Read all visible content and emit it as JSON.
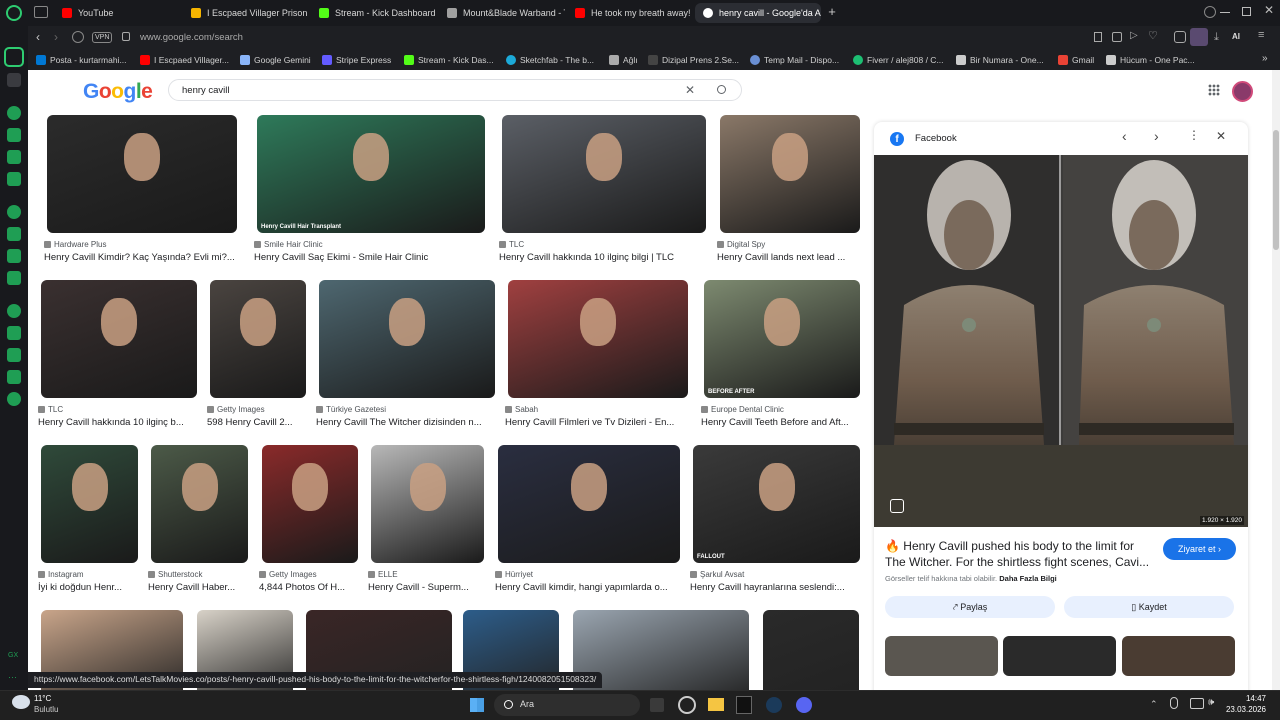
{
  "browser": {
    "tabs": [
      {
        "label": "YouTube",
        "color": "#ff0000"
      },
      {
        "label": "I Escpaed Villager Prison",
        "color": "#f5b400"
      },
      {
        "label": "Stream - Kick Dashboard",
        "color": "#53fc18"
      },
      {
        "label": "Mount&Blade Warband - T",
        "color": "#a0a0a0"
      },
      {
        "label": "He took my breath away!",
        "color": "#ff0000"
      },
      {
        "label": "henry cavill - Google'da A",
        "color": "#ffffff"
      }
    ],
    "vpn_label": "VPN",
    "url": "www.google.com/search",
    "ai_label": "AI",
    "bookmarks": [
      {
        "label": "Posta - kurtarmahi..."
      },
      {
        "label": "I Escpaed Villager..."
      },
      {
        "label": "Google Gemini"
      },
      {
        "label": "Stripe Express"
      },
      {
        "label": "Stream - Kick Das..."
      },
      {
        "label": "Sketchfab - The b..."
      },
      {
        "label": "Ağlı"
      },
      {
        "label": "Dizipal Prens 2.Se..."
      },
      {
        "label": "Temp Mail - Dispo..."
      },
      {
        "label": "Fiverr / alej808 / C..."
      },
      {
        "label": "Bir Numara - One..."
      },
      {
        "label": "Gmail"
      },
      {
        "label": "Hücum - One Pac..."
      }
    ],
    "status_url": "https://www.facebook.com/LetsTalkMovies.co/posts/-henry-cavill-pushed-his-body-to-the-limit-for-the-witcherfor-the-shirtless-figh/1240082051508323/"
  },
  "google": {
    "logo": "Google",
    "query": "henry cavill",
    "results": [
      {
        "source": "Hardware Plus",
        "title": "Henry Cavill Kimdir? Kaç Yaşında? Evli mi?...",
        "color": "#2b2b2b"
      },
      {
        "source": "Smile Hair Clinic",
        "title": "Henry Cavill Saç Ekimi - Smile Hair Clinic",
        "color": "#2e7a5a",
        "overlay": "Henry Cavill Hair Transplant"
      },
      {
        "source": "TLC",
        "title": "Henry Cavill hakkında 10 ilginç bilgi | TLC",
        "color": "#5b5f66"
      },
      {
        "source": "Digital Spy",
        "title": "Henry Cavill lands next lead ...",
        "color": "#8a7868"
      },
      {
        "source": "TLC",
        "title": "Henry Cavill hakkında 10 ilginç b...",
        "color": "#3a3030"
      },
      {
        "source": "Getty Images",
        "title": "598 Henry Cavill 2...",
        "color": "#4a4440"
      },
      {
        "source": "Türkiye Gazetesi",
        "title": "Henry Cavill The Witcher dizisinden n...",
        "color": "#4e6770"
      },
      {
        "source": "Sabah",
        "title": "Henry Cavill Filmleri ve Tv Dizileri - En...",
        "color": "#a04040"
      },
      {
        "source": "Europe Dental Clinic",
        "title": "Henry Cavill Teeth Before and Aft...",
        "color": "#7d8a70",
        "overlay": "BEFORE  AFTER"
      },
      {
        "source": "Instagram",
        "title": "İyi ki doğdun Henr...",
        "color": "#2f4a3a"
      },
      {
        "source": "Shutterstock",
        "title": "Henry Cavill Haber...",
        "color": "#4c5a48"
      },
      {
        "source": "Getty Images",
        "title": "4,844 Photos Of H...",
        "color": "#8a2a2a"
      },
      {
        "source": "ELLE",
        "title": "Henry Cavill - Superm...",
        "color": "#b8b8b8"
      },
      {
        "source": "Hürriyet",
        "title": "Henry Cavill kimdir, hangi yapımlarda o...",
        "color": "#2a2e40"
      },
      {
        "source": "Şarkul Avsat",
        "title": "Henry Cavill hayranlarına seslendi:...",
        "color": "#3a3a3a",
        "overlay": "FALLOUT"
      }
    ],
    "row4_colors": [
      "#c9a58a",
      "#d8d2c8",
      "#3a2626",
      "#2d5d8a",
      "#9aa5b0",
      "#2a2a2a"
    ],
    "panel": {
      "site": "Facebook",
      "dimensions": "1.920 × 1.920",
      "title": "🔥 Henry Cavill pushed his body to the limit for The Witcher. For the shirtless fight scenes, Cavi...",
      "visit_label": "Ziyaret et",
      "copyright": "Görseller telif hakkına tabi olabilir.",
      "learn_more": "Daha Fazla Bilgi",
      "share_label": "Paylaş",
      "save_label": "Kaydet"
    }
  },
  "taskbar": {
    "weather_temp": "11°C",
    "weather_desc": "Bulutlu",
    "search_label": "Ara",
    "time": "14:47",
    "date": "23.03.2026"
  }
}
